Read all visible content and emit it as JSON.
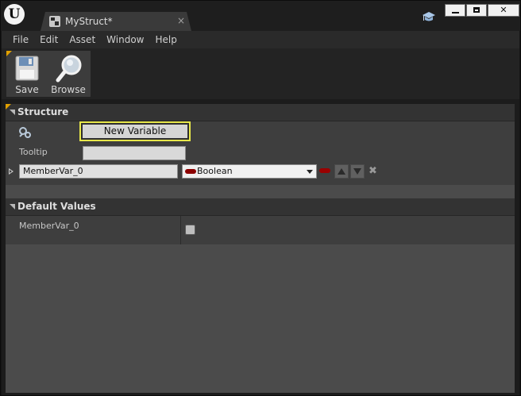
{
  "window": {
    "tab_title": "MyStruct*",
    "tab_close": "×",
    "logo": "U",
    "close_glyph": "✕"
  },
  "menu": {
    "items": [
      "File",
      "Edit",
      "Asset",
      "Window",
      "Help"
    ]
  },
  "toolbar": {
    "save_label": "Save",
    "browse_label": "Browse"
  },
  "structure": {
    "title": "Structure",
    "new_variable_label": "New Variable",
    "tooltip_label": "Tooltip",
    "tooltip_value": "",
    "member_name": "MemberVar_0",
    "member_type": "Boolean",
    "remove_glyph": "✖"
  },
  "defaults": {
    "title": "Default Values",
    "member_label": "MemberVar_0",
    "member_value": false
  },
  "colors": {
    "accent_highlight": "#e8e84a",
    "bool_pin": "#8c0000",
    "panel_bg": "#4b4b4b",
    "header_bg": "#333333"
  },
  "icons": [
    "unreal-logo-icon",
    "struct-icon",
    "graduation-cap-icon",
    "minimize-icon",
    "maximize-icon",
    "close-icon",
    "save-icon",
    "browse-icon",
    "variable-icon",
    "bool-pin-icon",
    "move-up-icon",
    "move-down-icon",
    "remove-icon"
  ]
}
